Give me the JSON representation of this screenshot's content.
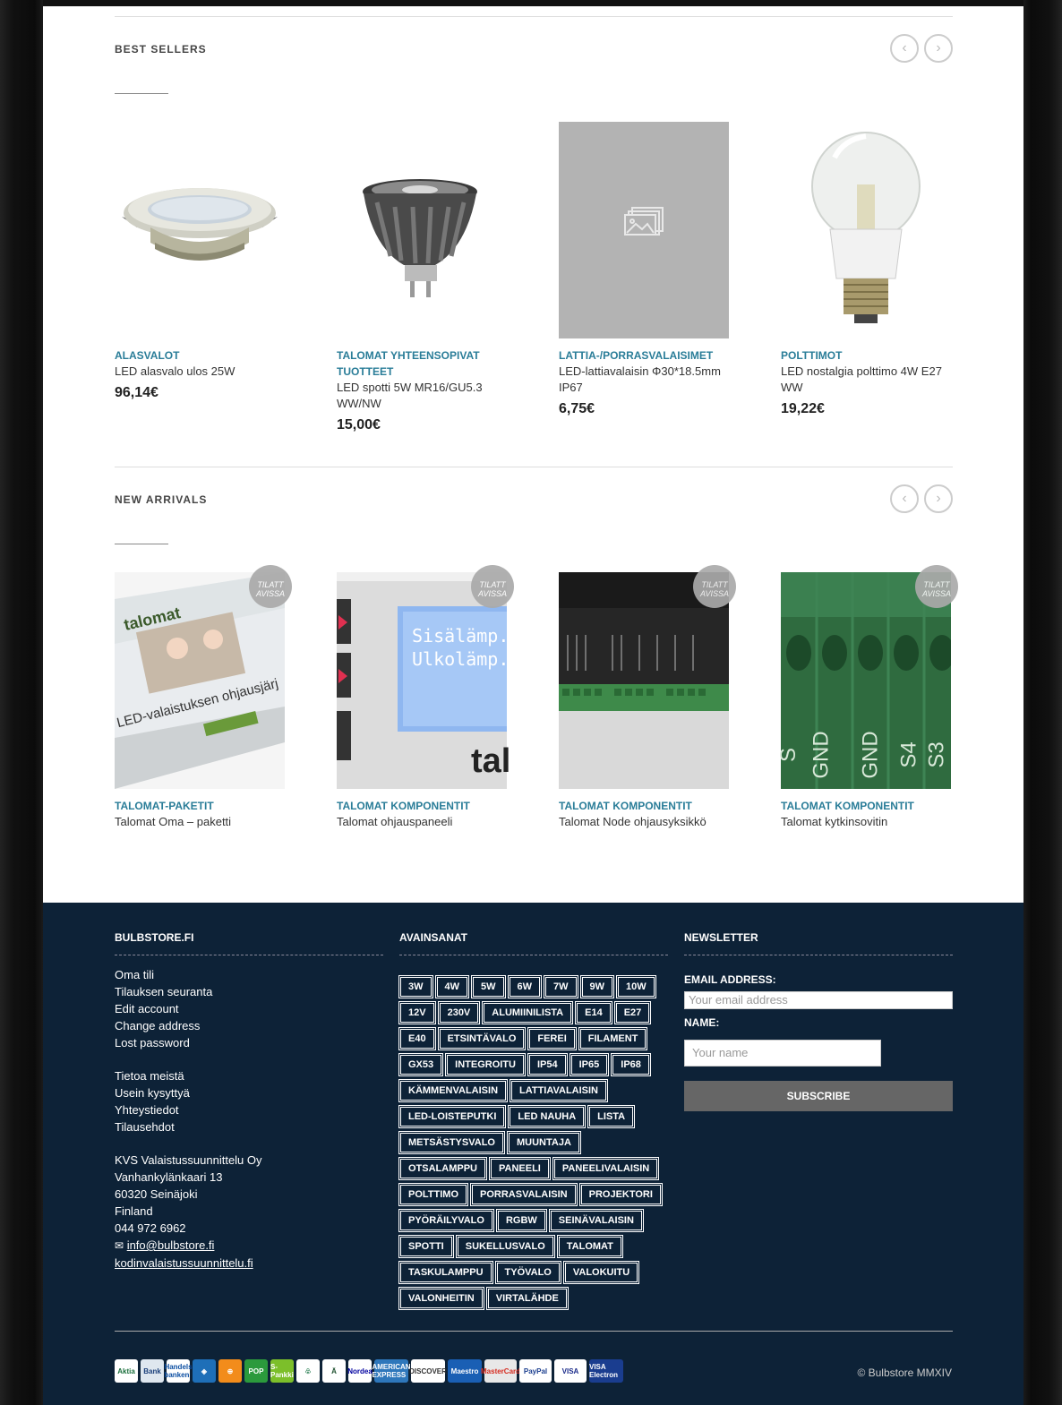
{
  "best_sellers": {
    "title": "BEST SELLERS",
    "products": [
      {
        "category": "ALASVALOT",
        "name": "LED alasvalo ulos 25W",
        "price": "96,14€"
      },
      {
        "category": "TALOMAT YHTEENSOPIVAT TUOTTEET",
        "name": "LED spotti 5W MR16/GU5.3 WW/NW",
        "price": "15,00€"
      },
      {
        "category": "LATTIA-/PORRASVALAISIMET",
        "name": "LED-lattiavalaisin Φ30*18.5mm IP67",
        "price": "6,75€"
      },
      {
        "category": "POLTTIMOT",
        "name": "LED nostalgia polttimo 4W E27 WW",
        "price": "19,22€"
      }
    ]
  },
  "new_arrivals": {
    "title": "NEW ARRIVALS",
    "badge_line1": "TILATT",
    "badge_line2": "AVISSA",
    "products": [
      {
        "category": "TALOMAT-PAKETIT",
        "name": "Talomat Oma – paketti"
      },
      {
        "category": "TALOMAT KOMPONENTIT",
        "name": "Talomat ohjauspaneeli"
      },
      {
        "category": "TALOMAT KOMPONENTIT",
        "name": "Talomat Node ohjausyksikkö"
      },
      {
        "category": "TALOMAT KOMPONENTIT",
        "name": "Talomat kytkinsovitin"
      }
    ],
    "image_text": {
      "box_brand": "talomat",
      "box_line": "LED-valaistuksen ohjausjärj",
      "lcd_line1": "Sisälämp.",
      "lcd_line2": "Ulkolämp.",
      "panel_brand": "tal",
      "terminal_labels": [
        "S",
        "GND",
        "GND",
        "S4",
        "S3"
      ]
    }
  },
  "footer": {
    "col1": {
      "title": "BULBSTORE.FI",
      "account_links": [
        "Oma tili",
        "Tilauksen seuranta",
        "Edit account",
        "Change address",
        "Lost password"
      ],
      "info_links": [
        "Tietoa meistä",
        "Usein kysyttyä",
        "Yhteystiedot",
        "Tilausehdot"
      ],
      "address": [
        "KVS Valaistussuunnittelu Oy",
        "Vanhankylänkaari 13",
        "60320 Seinäjoki",
        "Finland",
        "044 972 6962"
      ],
      "email": "info@bulbstore.fi",
      "website": "kodinvalaistussuunnittelu.fi"
    },
    "col2": {
      "title": "AVAINSANAT",
      "tags": [
        "3W",
        "4W",
        "5W",
        "6W",
        "7W",
        "9W",
        "10W",
        "12V",
        "230V",
        "ALUMIINILISTA",
        "E14",
        "E27",
        "E40",
        "ETSINTÄVALO",
        "FEREI",
        "FILAMENT",
        "GX53",
        "INTEGROITU",
        "IP54",
        "IP65",
        "IP68",
        "KÄMMENVALAISIN",
        "LATTIAVALAISIN",
        "LED-LOISTEPUTKI",
        "LED NAUHA",
        "LISTA",
        "METSÄSTYSVALO",
        "MUUNTAJA",
        "OTSALAMPPU",
        "PANEELI",
        "PANEELIVALAISIN",
        "POLTTIMO",
        "PORRASVALAISIN",
        "PROJEKTORI",
        "PYÖRÄILYVALO",
        "RGBW",
        "SEINÄVALAISIN",
        "SPOTTI",
        "SUKELLUSVALO",
        "TALOMAT",
        "TASKULAMPPU",
        "TYÖVALO",
        "VALOKUITU",
        "VALONHEITIN",
        "VIRTALÄHDE"
      ]
    },
    "col3": {
      "title": "NEWSLETTER",
      "email_label": "EMAIL ADDRESS:",
      "email_placeholder": "Your email address",
      "name_label": "NAME:",
      "name_placeholder": "Your name",
      "subscribe_label": "SUBSCRIBE"
    },
    "payments": [
      {
        "name": "Aktia",
        "bg": "#ffffff",
        "fg": "#1a6f3c"
      },
      {
        "name": "Bank",
        "bg": "#dfe7ef",
        "fg": "#1b3f7a"
      },
      {
        "name": "Handels banken",
        "bg": "#ffffff",
        "fg": "#0b4ea2"
      },
      {
        "name": "◈",
        "bg": "#1e6fb8",
        "fg": "#ffffff"
      },
      {
        "name": "⊕",
        "bg": "#f28c1b",
        "fg": "#ffffff"
      },
      {
        "name": "POP",
        "bg": "#2b9a3c",
        "fg": "#ffffff"
      },
      {
        "name": "S-Pankki",
        "bg": "#7cbf2a",
        "fg": "#ffffff"
      },
      {
        "name": "♧",
        "bg": "#ffffff",
        "fg": "#0b6d3a"
      },
      {
        "name": "Ä",
        "bg": "#ffffff",
        "fg": "#1d4f2d"
      },
      {
        "name": "Nordea",
        "bg": "#ffffff",
        "fg": "#0000a0"
      },
      {
        "name": "AMERICAN EXPRESS",
        "bg": "#2e77bb",
        "fg": "#ffffff"
      },
      {
        "name": "DISCOVER",
        "bg": "#ffffff",
        "fg": "#333333"
      },
      {
        "name": "Maestro",
        "bg": "#1a5fb4",
        "fg": "#ffffff"
      },
      {
        "name": "MasterCard",
        "bg": "#e8e8e8",
        "fg": "#d62b1f"
      },
      {
        "name": "PayPal",
        "bg": "#ffffff",
        "fg": "#1b3e8f"
      },
      {
        "name": "VISA",
        "bg": "#ffffff",
        "fg": "#1a2b8a"
      },
      {
        "name": "VISA Electron",
        "bg": "#1a3d8f",
        "fg": "#ffffff"
      }
    ],
    "copyright": "© Bulbstore MMXIV"
  }
}
